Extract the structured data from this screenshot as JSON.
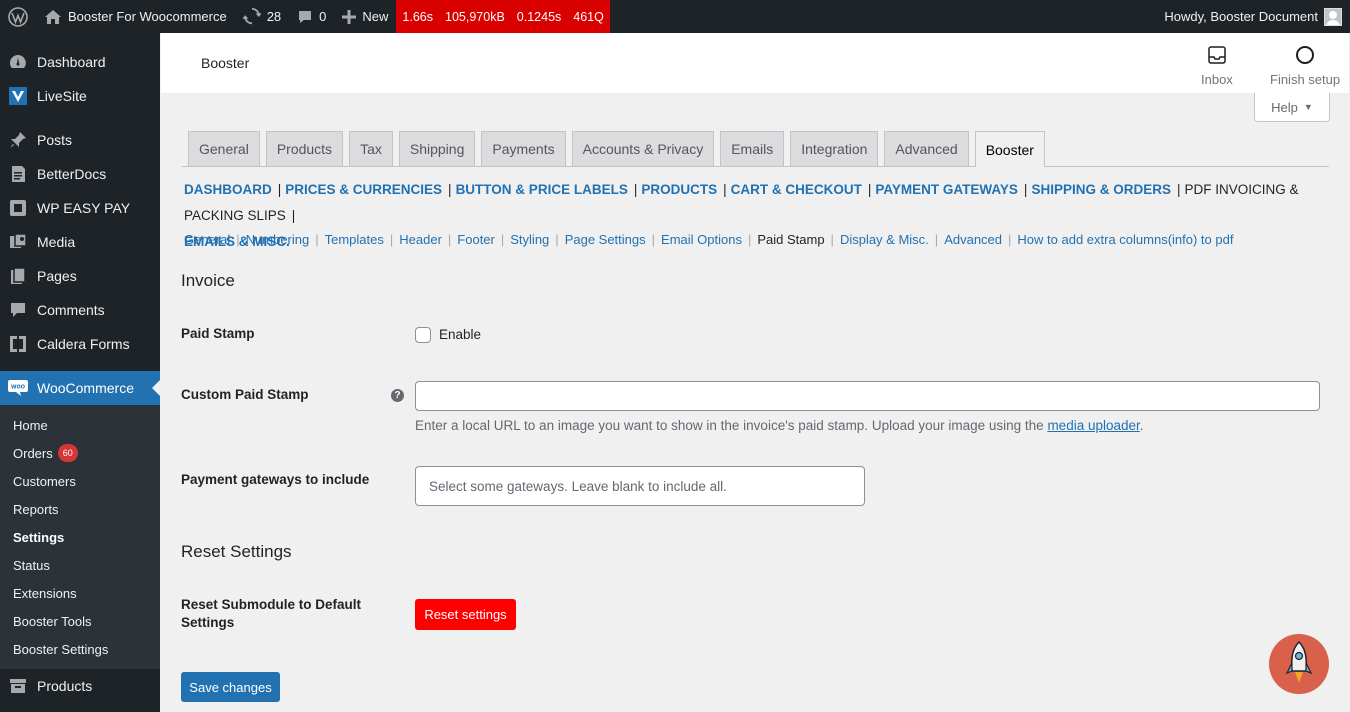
{
  "adminbar": {
    "site_name": "Booster For Woocommerce",
    "updates_count": "28",
    "comments_count": "0",
    "new_label": "New",
    "qm": [
      "1.66s",
      "105,970kB",
      "0.1245s",
      "461Q"
    ],
    "howdy": "Howdy, Booster Document"
  },
  "sidebar": {
    "items_top": [
      {
        "label": "Dashboard",
        "icon": "dashboard-icon"
      },
      {
        "label": "LiveSite",
        "icon": "livesite-icon"
      },
      {
        "label": "Posts",
        "icon": "pin-icon"
      },
      {
        "label": "BetterDocs",
        "icon": "docs-icon"
      },
      {
        "label": "WP EASY PAY",
        "icon": "pay-icon"
      },
      {
        "label": "Media",
        "icon": "media-icon"
      },
      {
        "label": "Pages",
        "icon": "pages-icon"
      },
      {
        "label": "Comments",
        "icon": "comment-icon"
      },
      {
        "label": "Caldera Forms",
        "icon": "caldera-icon"
      }
    ],
    "current": "WooCommerce",
    "submenu": [
      "Home",
      "Orders",
      "Customers",
      "Reports",
      "Settings",
      "Status",
      "Extensions",
      "Booster Tools",
      "Booster Settings"
    ],
    "orders_badge": "60",
    "bottom": "Products"
  },
  "header": {
    "title": "Booster",
    "inbox": "Inbox",
    "finish_setup": "Finish setup"
  },
  "help": "Help",
  "tabs": [
    "General",
    "Products",
    "Tax",
    "Shipping",
    "Payments",
    "Accounts & Privacy",
    "Emails",
    "Integration",
    "Advanced",
    "Booster"
  ],
  "active_tab": "Booster",
  "categories": [
    "DASHBOARD",
    "PRICES & CURRENCIES",
    "BUTTON & PRICE LABELS",
    "PRODUCTS",
    "CART & CHECKOUT",
    "PAYMENT GATEWAYS",
    "SHIPPING & ORDERS",
    "PDF INVOICING & PACKING SLIPS",
    "EMAILS & MISC."
  ],
  "sublinks": [
    "General",
    "Numbering",
    "Templates",
    "Header",
    "Footer",
    "Styling",
    "Page Settings",
    "Email Options",
    "Paid Stamp",
    "Display & Misc.",
    "Advanced",
    "How to add extra columns(info) to pdf"
  ],
  "form": {
    "section_invoice": "Invoice",
    "paid_stamp_label": "Paid Stamp",
    "enable_label": "Enable",
    "custom_stamp_label": "Custom Paid Stamp",
    "tip": "?",
    "custom_stamp_value": "",
    "desc_prefix": "Enter a local URL to an image you want to show in the invoice's paid stamp. Upload your image using the ",
    "desc_link": "media uploader",
    "desc_suffix": ".",
    "gateways_label": "Payment gateways to include",
    "gateways_placeholder": "Select some gateways. Leave blank to include all.",
    "section_reset": "Reset Settings",
    "reset_label": "Reset Submodule to Default Settings",
    "reset_button": "Reset settings",
    "save_button": "Save changes"
  },
  "colors": {
    "accent": "#2271b1",
    "danger": "#ff0000",
    "adminbar": "#1d2327"
  }
}
